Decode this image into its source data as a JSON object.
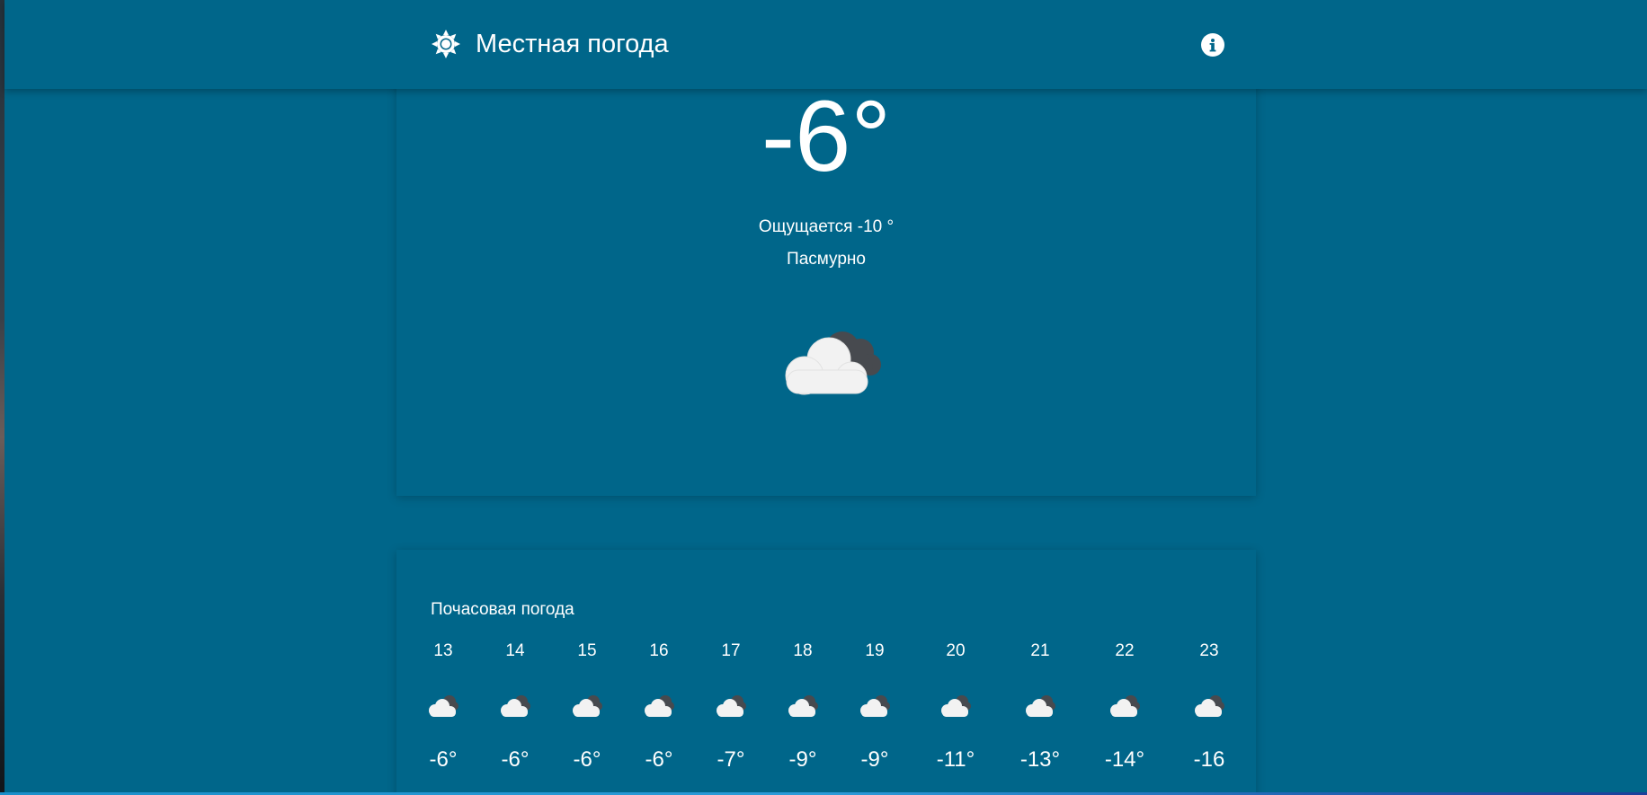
{
  "header": {
    "title": "Местная погода",
    "logo_icon": "sun-icon",
    "info_icon": "info-icon"
  },
  "current": {
    "temperature": "-6°",
    "feels_like": "Ощущается -10 °",
    "condition": "Пасмурно",
    "icon": "cloudy-icon"
  },
  "hourly": {
    "title": "Почасовая погода",
    "items": [
      {
        "hour": "13",
        "temp": "-6°",
        "icon": "cloudy-icon"
      },
      {
        "hour": "14",
        "temp": "-6°",
        "icon": "cloudy-icon"
      },
      {
        "hour": "15",
        "temp": "-6°",
        "icon": "cloudy-icon"
      },
      {
        "hour": "16",
        "temp": "-6°",
        "icon": "cloudy-icon"
      },
      {
        "hour": "17",
        "temp": "-7°",
        "icon": "cloudy-icon"
      },
      {
        "hour": "18",
        "temp": "-9°",
        "icon": "cloudy-icon"
      },
      {
        "hour": "19",
        "temp": "-9°",
        "icon": "cloudy-icon"
      },
      {
        "hour": "20",
        "temp": "-11°",
        "icon": "cloudy-icon"
      },
      {
        "hour": "21",
        "temp": "-13°",
        "icon": "cloudy-icon"
      },
      {
        "hour": "22",
        "temp": "-14°",
        "icon": "cloudy-icon"
      },
      {
        "hour": "23",
        "temp": "-16",
        "icon": "cloudy-icon"
      }
    ]
  },
  "colors": {
    "background": "#00668a",
    "text": "#ffffff",
    "cloud_light": "#f2f2f2",
    "cloud_dark": "#474a4f"
  }
}
